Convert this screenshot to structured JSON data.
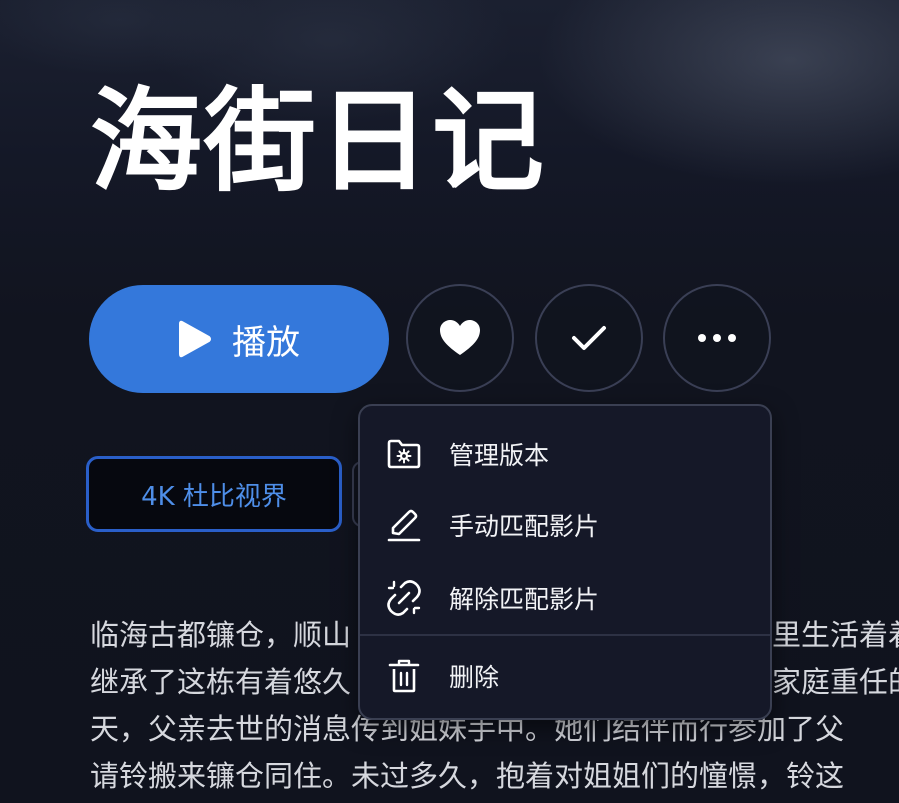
{
  "movie": {
    "title": "海街日记"
  },
  "actions": {
    "play_label": "播放",
    "favorite_icon": "heart-icon",
    "watched_icon": "check-icon",
    "more_icon": "more-horizontal-icon"
  },
  "tags": [
    {
      "label": "4K 杜比视界"
    }
  ],
  "description_lines": [
    "临海古都镰仓，顺山",
    "继承了这栋有着悠久",
    "天，父亲去世的消息传到姐妹手中。她们结伴而行参加了父",
    "请铃搬来镰仓同住。未过多久，抱着对姐姐们的憧憬，铃这"
  ],
  "description_right_fragments": [
    "里生活着着",
    "家庭重任的"
  ],
  "menu": {
    "items": [
      {
        "label": "管理版本",
        "icon": "folder-settings-icon"
      },
      {
        "label": "手动匹配影片",
        "icon": "pencil-icon"
      },
      {
        "label": "解除匹配影片",
        "icon": "unlink-icon"
      },
      {
        "label": "删除",
        "icon": "trash-icon"
      }
    ]
  },
  "colors": {
    "accent": "#3478db",
    "background": "#10131f",
    "menu_background": "#151828",
    "tag_border": "#2a5fc9"
  }
}
